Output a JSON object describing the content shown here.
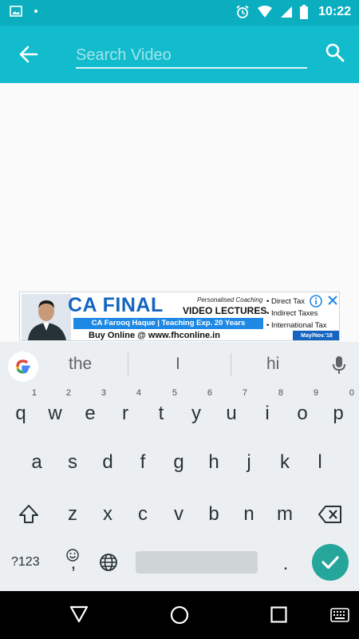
{
  "status_bar": {
    "time": "10:22"
  },
  "app_bar": {
    "search_placeholder": "Search Video",
    "search_value": ""
  },
  "ad": {
    "title": "CA FINAL",
    "subtitle_small": "Personalised Coaching",
    "subtitle_big": "VIDEO LECTURES",
    "bullets": [
      "• Direct Tax",
      "• Indirect Taxes",
      "• International Tax"
    ],
    "strip": "CA Farooq Haque | Teaching Exp. 20 Years",
    "buy_text": "Buy Online @ www.fhconline.in",
    "tag": "May/Nov.'18"
  },
  "keyboard": {
    "suggestions": [
      "the",
      "I",
      "hi"
    ],
    "row1": [
      {
        "key": "q",
        "hint": "1"
      },
      {
        "key": "w",
        "hint": "2"
      },
      {
        "key": "e",
        "hint": "3"
      },
      {
        "key": "r",
        "hint": "4"
      },
      {
        "key": "t",
        "hint": "5"
      },
      {
        "key": "y",
        "hint": "6"
      },
      {
        "key": "u",
        "hint": "7"
      },
      {
        "key": "i",
        "hint": "8"
      },
      {
        "key": "o",
        "hint": "9"
      },
      {
        "key": "p",
        "hint": "0"
      }
    ],
    "row2": [
      "a",
      "s",
      "d",
      "f",
      "g",
      "h",
      "j",
      "k",
      "l"
    ],
    "row3": [
      "z",
      "x",
      "c",
      "v",
      "b",
      "n",
      "m"
    ],
    "symbols_label": "?123",
    "comma": ",",
    "period": ".",
    "accent_color": "#26a69a"
  },
  "colors": {
    "status_bar": "#0aaebf",
    "app_bar": "#13bccd",
    "keyboard_bg": "#eceff1",
    "nav_bar": "#000000"
  }
}
